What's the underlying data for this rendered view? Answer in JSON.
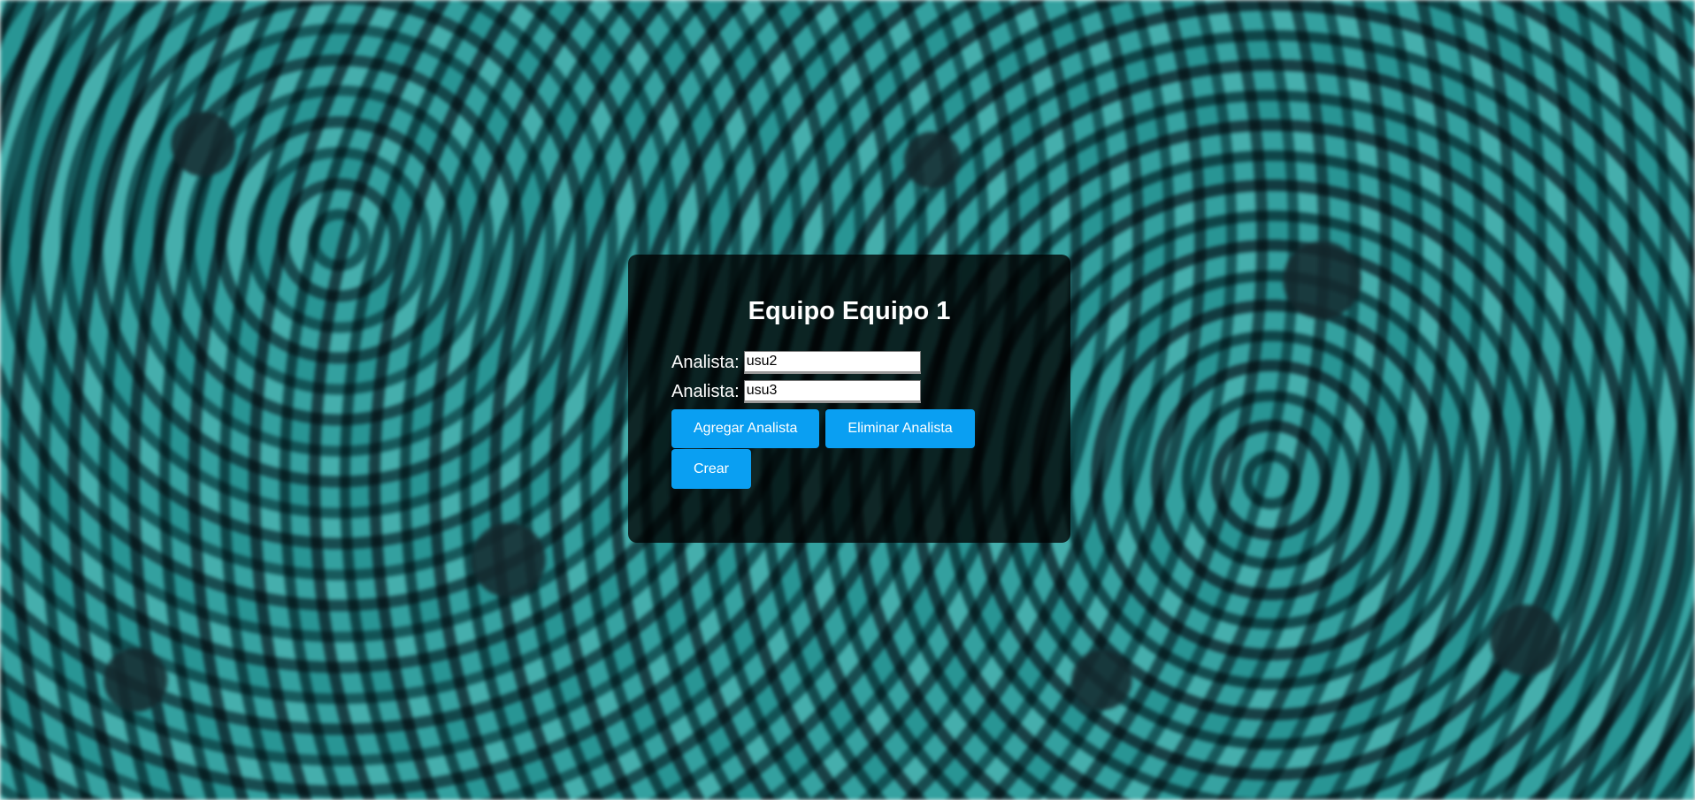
{
  "form": {
    "title": "Equipo Equipo 1",
    "analysts": [
      {
        "label": "Analista:",
        "value": "usu2"
      },
      {
        "label": "Analista:",
        "value": "usu3"
      }
    ],
    "add_button": "Agregar Analista",
    "remove_button": "Eliminar Analista",
    "create_button": "Crear"
  },
  "colors": {
    "button": "#0a9ff2",
    "card": "rgba(0,0,0,0.78)"
  }
}
